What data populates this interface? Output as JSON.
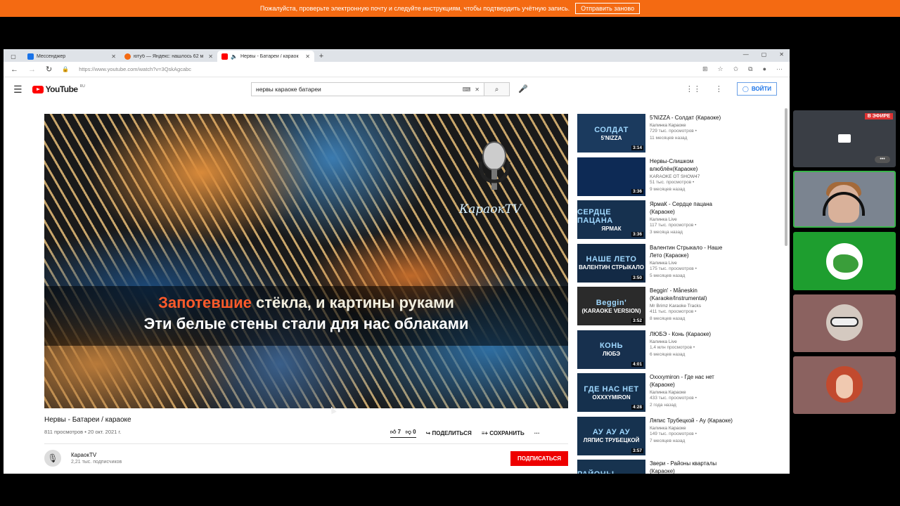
{
  "banner": {
    "text": "Пожалуйста, проверьте электронную почту и следуйте инструкциям, чтобы подтвердить учётную запись.",
    "button": "Отправить заново"
  },
  "browser": {
    "tabs": [
      {
        "label": "Мессенджер",
        "icon_color": "#1a73e8"
      },
      {
        "label": "ютуб — Яндекс: нашлось 62 м",
        "icon_color": "#f46a12"
      },
      {
        "label": "Нервы - Батареи / караок",
        "icon_color": "#f00"
      }
    ],
    "new_tab": "+",
    "url": "https://www.youtube.com/watch?v=3QskAgcabc"
  },
  "youtube": {
    "logo": "YouTube",
    "region": "RU",
    "search_query": "нервы караоке батареи",
    "signin": "ВОЙТИ",
    "video": {
      "lyric_sung": "Запотевшие",
      "lyric_rest": " стёкла, и картины руками",
      "lyric_line2": "Эти белые стены стали для нас облаками",
      "brand": "КараокTV",
      "title": "Нервы - Батареи / караоке",
      "meta": "811 просмотров • 20 окт. 2021 г.",
      "likes": "7",
      "dislikes": "0",
      "share": "ПОДЕЛИТЬСЯ",
      "save": "СОХРАНИТЬ",
      "more": "···"
    },
    "channel": {
      "name": "КараокTV",
      "subs": "2,21 тыс. подписчиков",
      "subscribe": "ПОДПИСАТЬСЯ"
    },
    "recs": [
      {
        "t1": "СОЛДАТ",
        "t2": "5'NIZZA",
        "bg": "#1b3a5e",
        "dur": "3:14",
        "title": "5'NIZZA - Солдат (Караоке)",
        "channel": "Калинка Караоке",
        "views": "729 тыс. просмотров •",
        "ago": "11 месяцев назад"
      },
      {
        "t1": "",
        "t2": "",
        "bg": "#0d2a55",
        "dur": "3:36",
        "title": "Нервы-Слишком влюблён(Караоке)",
        "channel": "KARAOKE OT SHOW47",
        "views": "51 тыс. просмотров •",
        "ago": "9 месяцев назад"
      },
      {
        "t1": "СЕРДЦЕ ПАЦАНА",
        "t2": "ЯРМАК",
        "bg": "#16314f",
        "dur": "3:36",
        "title": "ЯрмаК - Сердце пацана (Караоке)",
        "channel": "Калинка Live",
        "views": "117 тыс. просмотров •",
        "ago": "3 месяца назад"
      },
      {
        "t1": "НАШЕ ЛЕТО",
        "t2": "ВАЛЕНТИН СТРЫКАЛО",
        "bg": "#132a45",
        "dur": "3:50",
        "title": "Валентин Стрыкало - Наше Лето (Караоке)",
        "channel": "Калинка Live",
        "views": "175 тыс. просмотров •",
        "ago": "5 месяцев назад"
      },
      {
        "t1": "Beggin'",
        "t2": "(KARAOKE VERSION)",
        "bg": "#2b2b2b",
        "dur": "3:52",
        "title": "Beggin' - Måneskin (Karaoke/Instrumental)",
        "channel": "Mr Brimz Karaoke Tracks",
        "views": "411 тыс. просмотров •",
        "ago": "8 месяцев назад"
      },
      {
        "t1": "КОНЬ",
        "t2": "ЛЮБЭ",
        "bg": "#17304e",
        "dur": "4:01",
        "title": "ЛЮБЭ - Конь (Караоке)",
        "channel": "Калинка Live",
        "views": "1,4 млн просмотров •",
        "ago": "6 месяцев назад"
      },
      {
        "t1": "ГДЕ НАС НЕТ",
        "t2": "OXXXYMIRON",
        "bg": "#15304d",
        "dur": "4:28",
        "title": "Oxxxymiron - Где нас нет (Караоке)",
        "channel": "Калинка Караоке",
        "views": "433 тыс. просмотров •",
        "ago": "2 года назад"
      },
      {
        "t1": "АУ АУ АУ",
        "t2": "ЛЯПИС ТРУБЕЦКОЙ",
        "bg": "#16324f",
        "dur": "3:57",
        "title": "Ляпис Трубецкой - Ау (Караоке)",
        "channel": "Калинка Караоке",
        "views": "149 тыс. просмотров •",
        "ago": "7 месяцев назад"
      },
      {
        "t1": "РАЙОНЫ КВАРТАЛЫ",
        "t2": "",
        "bg": "#17334f",
        "dur": "",
        "title": "Звери - Районы кварталы (Караоке)",
        "channel": "",
        "views": "",
        "ago": ""
      }
    ]
  },
  "sidebar": {
    "live_badge": "В ЭФИРЕ",
    "more": "•••"
  }
}
